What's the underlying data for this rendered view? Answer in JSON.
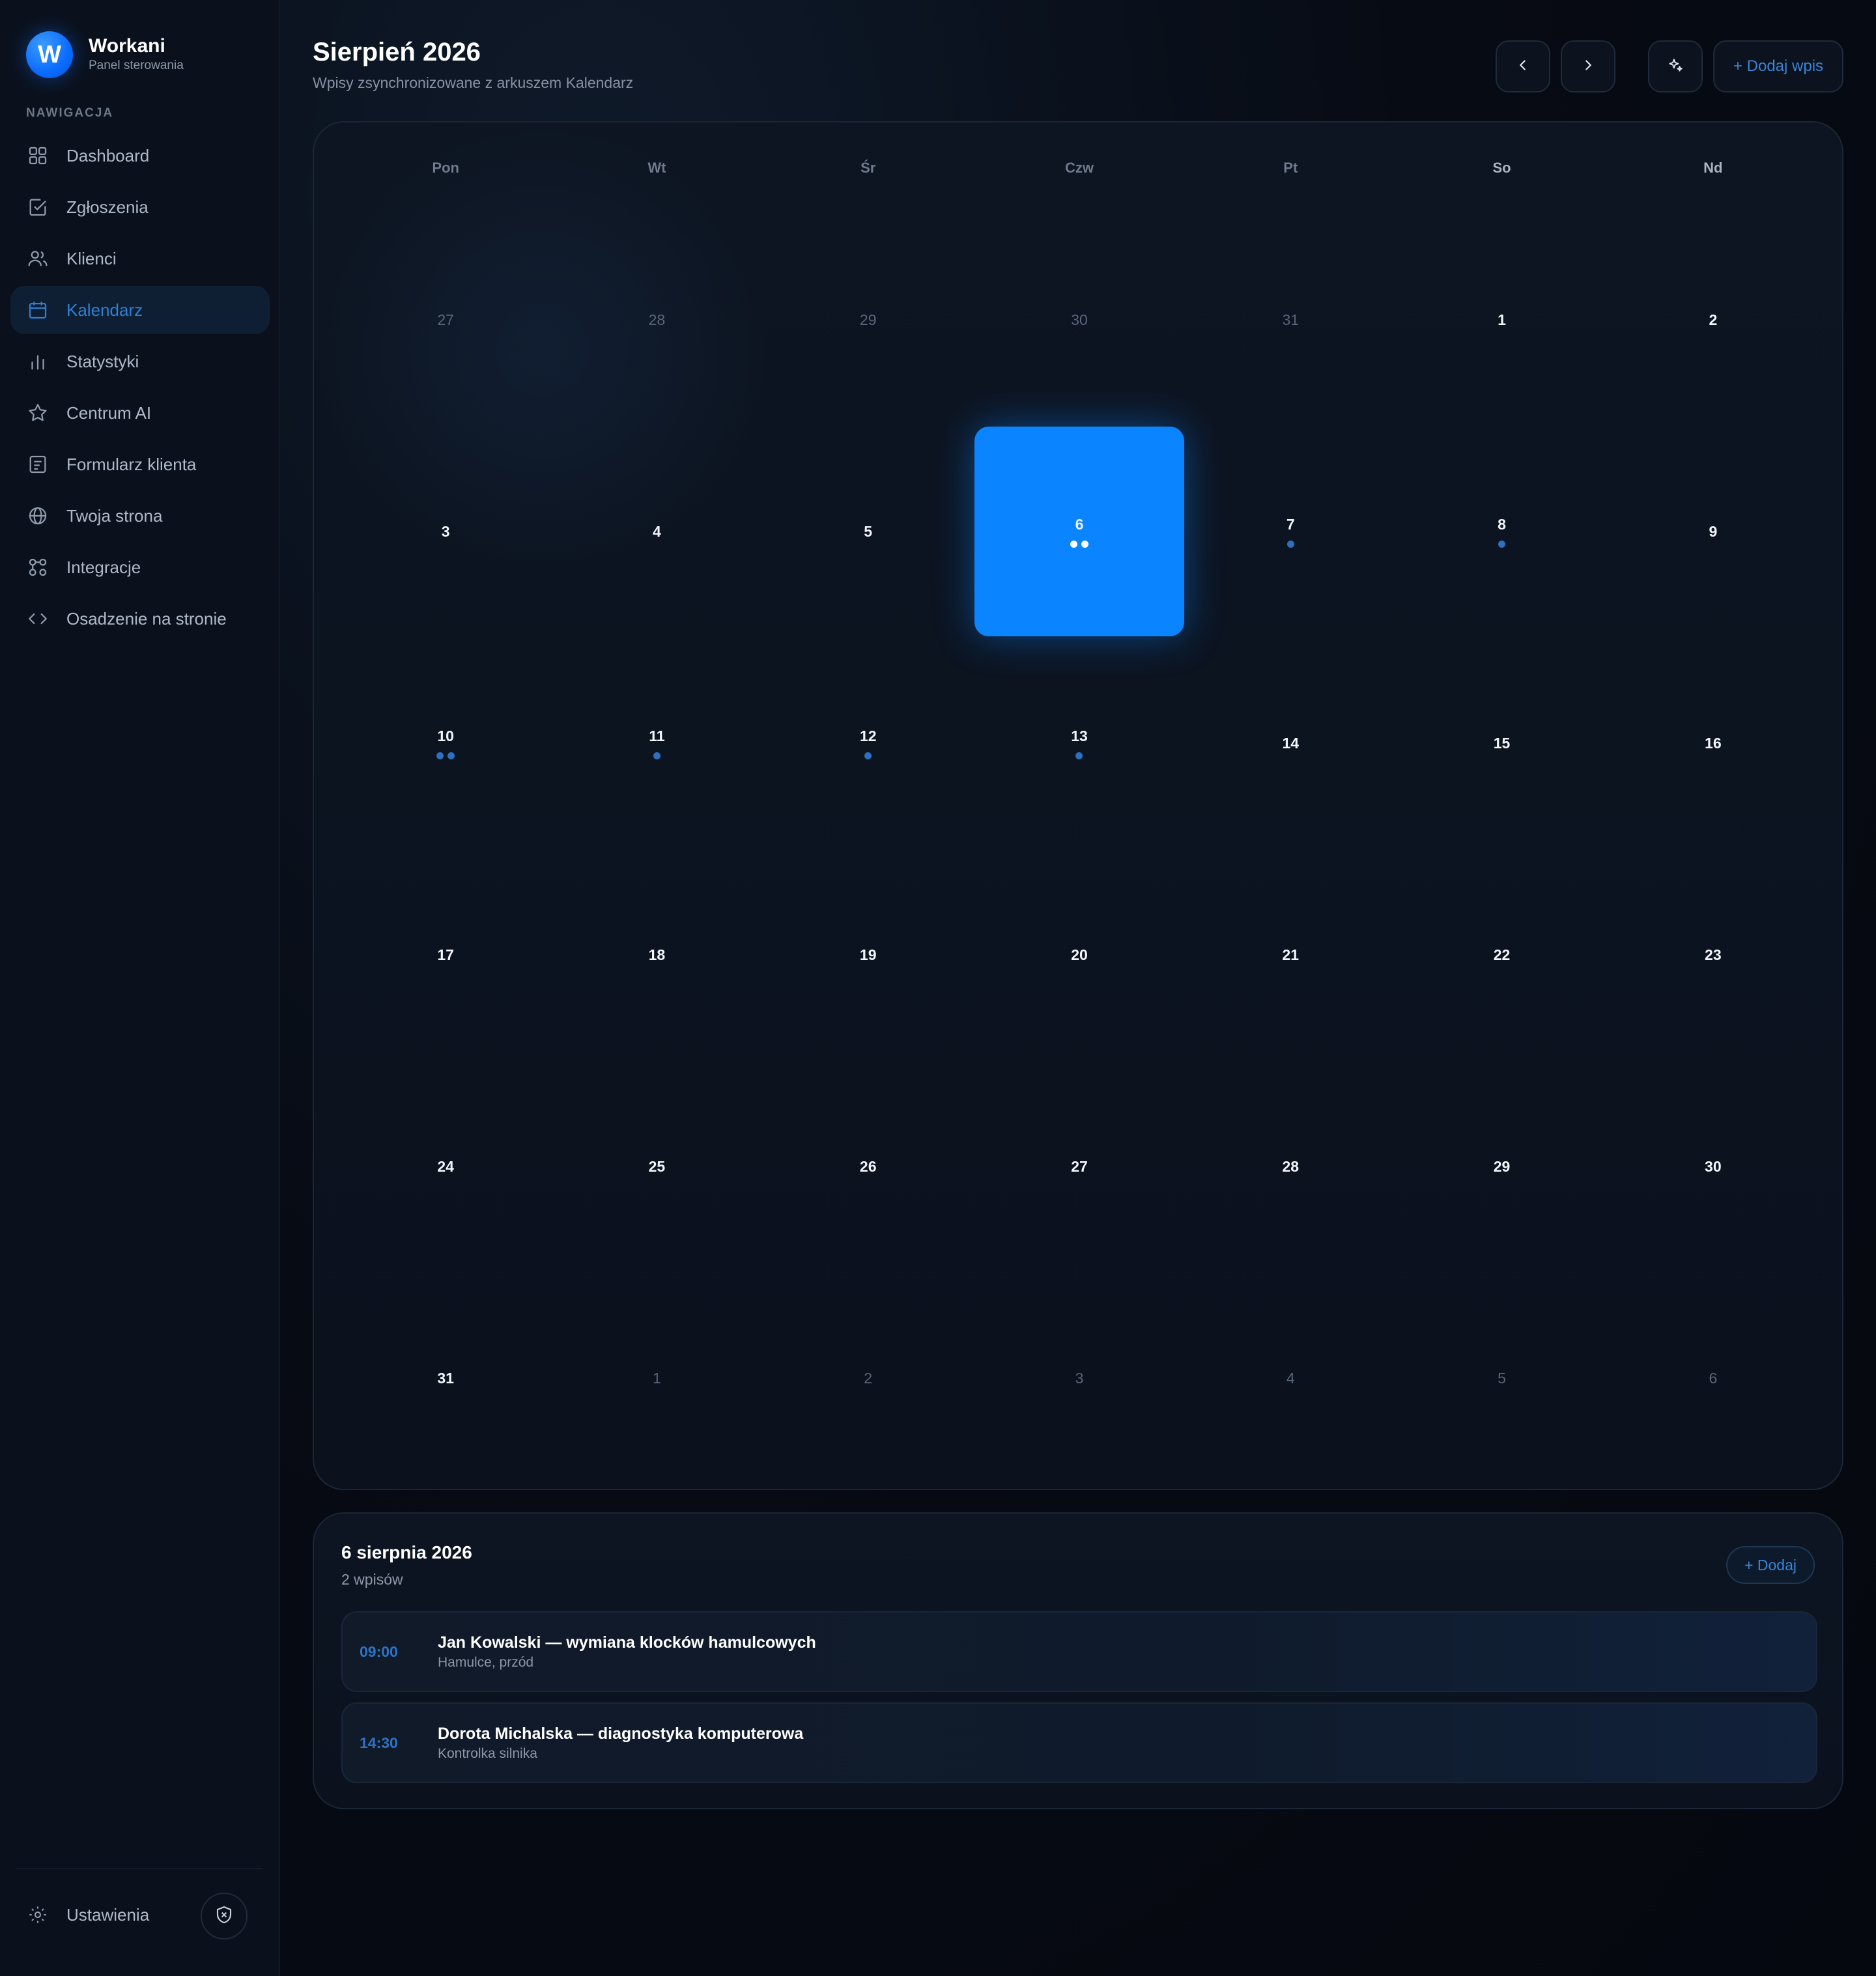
{
  "brand": {
    "logo_letter": "W",
    "name": "Workani",
    "subtitle": "Panel sterowania"
  },
  "nav": {
    "header": "NAWIGACJA",
    "items": [
      {
        "label": "Dashboard",
        "icon": "grid-icon",
        "active": false
      },
      {
        "label": "Zgłoszenia",
        "icon": "checkbox-icon",
        "active": false
      },
      {
        "label": "Klienci",
        "icon": "users-icon",
        "active": false
      },
      {
        "label": "Kalendarz",
        "icon": "calendar-icon",
        "active": true
      },
      {
        "label": "Statystyki",
        "icon": "bar-chart-icon",
        "active": false
      },
      {
        "label": "Centrum AI",
        "icon": "star-icon",
        "active": false
      },
      {
        "label": "Formularz klienta",
        "icon": "form-icon",
        "active": false
      },
      {
        "label": "Twoja strona",
        "icon": "globe-icon",
        "active": false
      },
      {
        "label": "Integracje",
        "icon": "integrations-icon",
        "active": false
      },
      {
        "label": "Osadzenie na stronie",
        "icon": "code-icon",
        "active": false
      }
    ],
    "settings_label": "Ustawienia"
  },
  "header": {
    "title": "Sierpień 2026",
    "subtitle": "Wpisy zsynchronizowane z arkuszem Kalendarz",
    "add_label": "+ Dodaj wpis"
  },
  "calendar": {
    "weekdays": [
      "Pon",
      "Wt",
      "Śr",
      "Czw",
      "Pt",
      "So",
      "Nd"
    ],
    "weeks": [
      [
        {
          "n": "27",
          "m": true,
          "d": 0
        },
        {
          "n": "28",
          "m": true,
          "d": 0
        },
        {
          "n": "29",
          "m": true,
          "d": 0
        },
        {
          "n": "30",
          "m": true,
          "d": 0
        },
        {
          "n": "31",
          "m": true,
          "d": 0
        },
        {
          "n": "1",
          "m": false,
          "d": 0
        },
        {
          "n": "2",
          "m": false,
          "d": 0
        }
      ],
      [
        {
          "n": "3",
          "m": false,
          "d": 0
        },
        {
          "n": "4",
          "m": false,
          "d": 0
        },
        {
          "n": "5",
          "m": false,
          "d": 0
        },
        {
          "n": "6",
          "m": false,
          "d": 2,
          "sel": true
        },
        {
          "n": "7",
          "m": false,
          "d": 1
        },
        {
          "n": "8",
          "m": false,
          "d": 1
        },
        {
          "n": "9",
          "m": false,
          "d": 0
        }
      ],
      [
        {
          "n": "10",
          "m": false,
          "d": 2
        },
        {
          "n": "11",
          "m": false,
          "d": 1
        },
        {
          "n": "12",
          "m": false,
          "d": 1
        },
        {
          "n": "13",
          "m": false,
          "d": 1
        },
        {
          "n": "14",
          "m": false,
          "d": 0
        },
        {
          "n": "15",
          "m": false,
          "d": 0
        },
        {
          "n": "16",
          "m": false,
          "d": 0
        }
      ],
      [
        {
          "n": "17",
          "m": false,
          "d": 0
        },
        {
          "n": "18",
          "m": false,
          "d": 0
        },
        {
          "n": "19",
          "m": false,
          "d": 0
        },
        {
          "n": "20",
          "m": false,
          "d": 0
        },
        {
          "n": "21",
          "m": false,
          "d": 0
        },
        {
          "n": "22",
          "m": false,
          "d": 0
        },
        {
          "n": "23",
          "m": false,
          "d": 0
        }
      ],
      [
        {
          "n": "24",
          "m": false,
          "d": 0
        },
        {
          "n": "25",
          "m": false,
          "d": 0
        },
        {
          "n": "26",
          "m": false,
          "d": 0
        },
        {
          "n": "27",
          "m": false,
          "d": 0
        },
        {
          "n": "28",
          "m": false,
          "d": 0
        },
        {
          "n": "29",
          "m": false,
          "d": 0
        },
        {
          "n": "30",
          "m": false,
          "d": 0
        }
      ],
      [
        {
          "n": "31",
          "m": false,
          "d": 0
        },
        {
          "n": "1",
          "m": true,
          "d": 0
        },
        {
          "n": "2",
          "m": true,
          "d": 0
        },
        {
          "n": "3",
          "m": true,
          "d": 0
        },
        {
          "n": "4",
          "m": true,
          "d": 0
        },
        {
          "n": "5",
          "m": true,
          "d": 0
        },
        {
          "n": "6",
          "m": true,
          "d": 0
        }
      ]
    ]
  },
  "detail": {
    "title": "6 sierpnia 2026",
    "count": "2 wpisów",
    "add_label": "+ Dodaj",
    "entries": [
      {
        "time": "09:00",
        "title": "Jan Kowalski — wymiana klocków hamulcowych",
        "subtitle": "Hamulce, przód"
      },
      {
        "time": "14:30",
        "title": "Dorota Michalska — diagnostyka komputerowa",
        "subtitle": "Kontrolka silnika"
      }
    ]
  },
  "colors": {
    "accent": "#0b84ff",
    "accent_text": "#2f7fd4",
    "background": "#05080f",
    "sidebar": "#0b111c"
  }
}
